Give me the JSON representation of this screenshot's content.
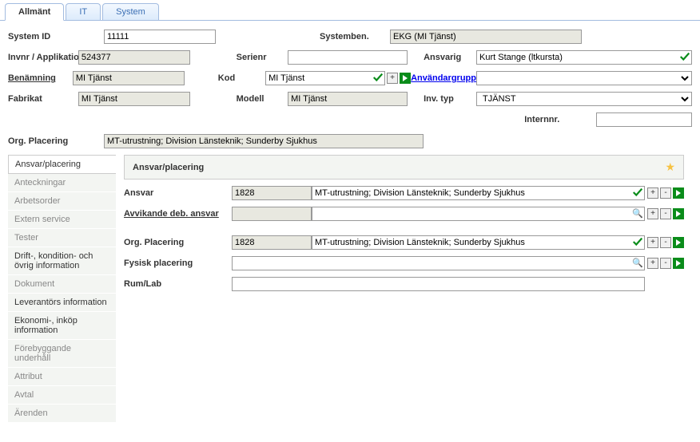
{
  "topTabs": [
    "Allmänt",
    "IT",
    "System"
  ],
  "activeTab": 0,
  "form": {
    "systemId": {
      "label": "System ID",
      "value": "11111"
    },
    "systemben": {
      "label": "Systemben.",
      "value": "EKG (MI Tjänst)"
    },
    "invnr": {
      "label": "Invnr / Applikation",
      "value": "524377"
    },
    "serienr": {
      "label": "Serienr",
      "value": ""
    },
    "ansvarig": {
      "label": "Ansvarig",
      "value": "Kurt Stange (ltkursta)"
    },
    "benamning": {
      "label": "Benämning",
      "value": "MI Tjänst"
    },
    "kod": {
      "label": "Kod",
      "value": "MI Tjänst"
    },
    "anvgrupp": {
      "label": "Användargrupp",
      "value": ""
    },
    "fabrikat": {
      "label": "Fabrikat",
      "value": "MI Tjänst"
    },
    "modell": {
      "label": "Modell",
      "value": "MI Tjänst"
    },
    "invtyp": {
      "label": "Inv. typ",
      "value": "TJÄNST"
    },
    "internnr": {
      "label": "Internnr.",
      "value": ""
    },
    "orgPlacering": {
      "label": "Org. Placering",
      "value": "MT-utrustning; Division Länsteknik; Sunderby Sjukhus"
    }
  },
  "sideTabs": [
    "Ansvar/placering",
    "Anteckningar",
    "Arbetsorder",
    "Extern service",
    "Tester",
    "Drift-, kondition- och övrig information",
    "Dokument",
    "Leverantörs information",
    "Ekonomi-, inköp information",
    "Förebyggande underhåll",
    "Attribut",
    "Avtal",
    "Ärenden"
  ],
  "activeSideTab": 0,
  "panel": {
    "title": "Ansvar/placering",
    "ansvar": {
      "label": "Ansvar",
      "code": "1828",
      "desc": "MT-utrustning; Division Länsteknik; Sunderby Sjukhus"
    },
    "avvik": {
      "label": "Avvikande deb. ansvar",
      "code": "",
      "desc": ""
    },
    "org": {
      "label": "Org. Placering",
      "code": "1828",
      "desc": "MT-utrustning; Division Länsteknik; Sunderby Sjukhus"
    },
    "fysisk": {
      "label": "Fysisk placering",
      "value": ""
    },
    "rum": {
      "label": "Rum/Lab",
      "value": ""
    }
  }
}
